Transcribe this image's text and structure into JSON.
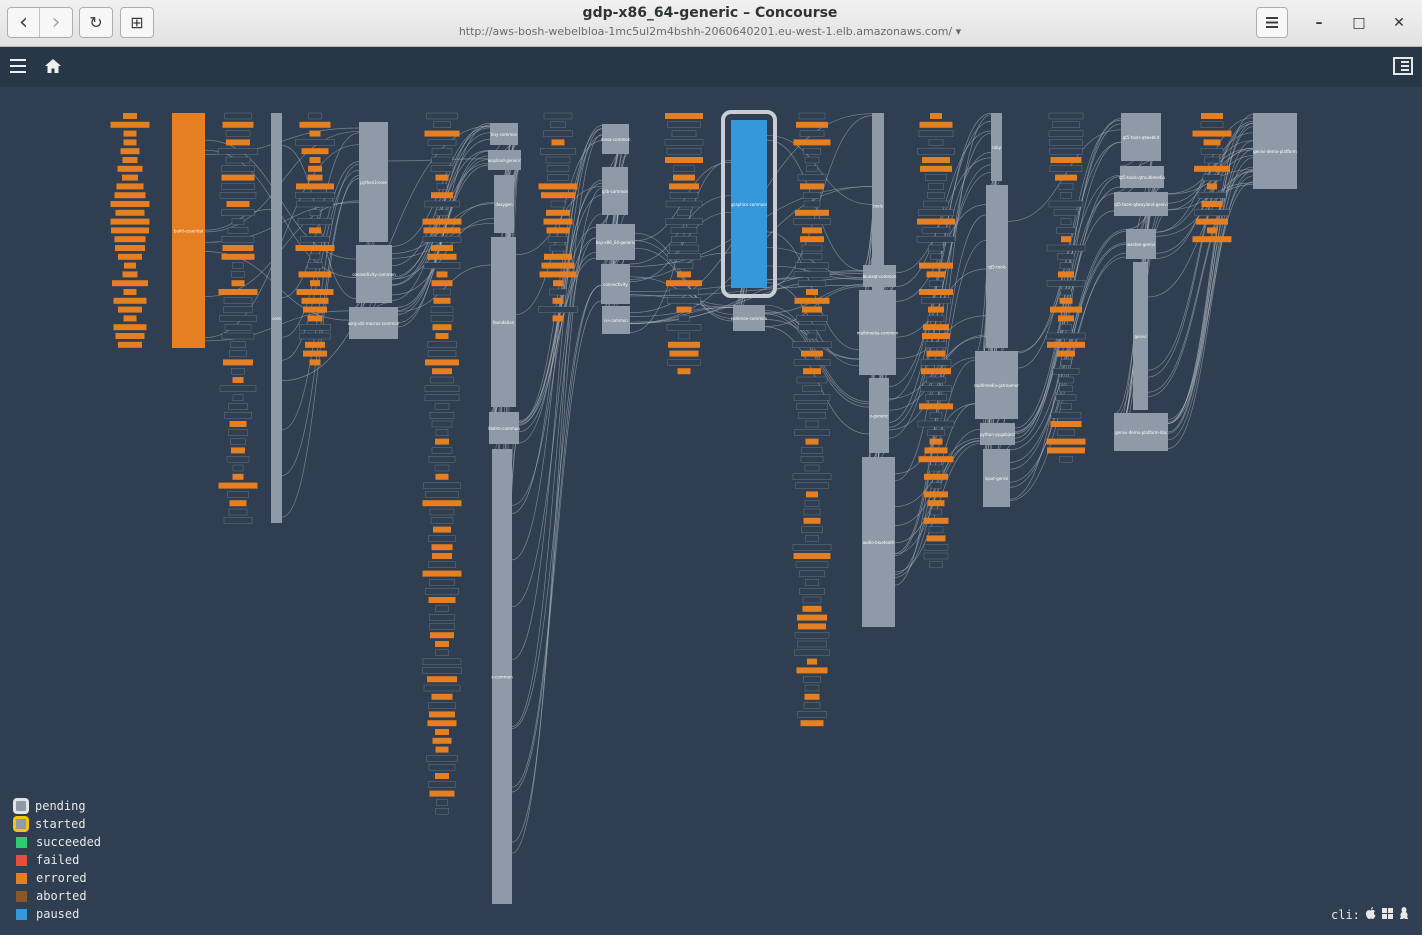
{
  "browser": {
    "window_title": "gdp-x86_64-generic – Concourse",
    "url": "http://aws-bosh-webelbloa-1mc5ul2m4bshh-2060640201.eu-west-1.elb.amazonaws.com/",
    "url_dropdown": "▾",
    "back_icon": "‹",
    "forward_icon": "›",
    "reload_icon": "↻",
    "new_tab_icon": "⊞",
    "minimize_icon": "–",
    "maximize_icon": "□",
    "close_icon": "✕"
  },
  "pipeline": {
    "jobs": [
      {
        "label": "build-essential",
        "status": "errored"
      },
      {
        "label": "core",
        "status": "pending"
      },
      {
        "label": "python3-core",
        "status": "pending"
      },
      {
        "label": "connectivity-common",
        "status": "pending"
      },
      {
        "label": "xorg-util-macros-common",
        "status": "pending"
      },
      {
        "label": "tiny-common",
        "status": "pending"
      },
      {
        "label": "wayland-generic",
        "status": "pending"
      },
      {
        "label": "doxygen",
        "status": "pending"
      },
      {
        "label": "foundation",
        "status": "pending"
      },
      {
        "label": "libdrm-common",
        "status": "pending"
      },
      {
        "label": "x-common",
        "status": "pending"
      },
      {
        "label": "mesa-common",
        "status": "pending"
      },
      {
        "label": "glib-common",
        "status": "pending"
      },
      {
        "label": "bsp-x86_64-generic",
        "status": "pending"
      },
      {
        "label": "connectivity",
        "status": "pending"
      },
      {
        "label": "ivi-common",
        "status": "pending"
      },
      {
        "label": "graphics-common",
        "status": "paused"
      },
      {
        "label": "common-common",
        "status": "pending"
      },
      {
        "label": "tools",
        "status": "pending"
      },
      {
        "label": "bluezqt-common",
        "status": "pending"
      },
      {
        "label": "multimedia-common",
        "status": "pending"
      },
      {
        "label": "x-generic",
        "status": "pending"
      },
      {
        "label": "audio-bluetooth",
        "status": "pending"
      },
      {
        "label": "ruby",
        "status": "pending"
      },
      {
        "label": "qt5-tools",
        "status": "pending"
      },
      {
        "label": "multimedia-gstreamer",
        "status": "pending"
      },
      {
        "label": "python-pygobject",
        "status": "pending"
      },
      {
        "label": "input-genivi",
        "status": "pending"
      },
      {
        "label": "qt5-tools-qtwebkit",
        "status": "pending"
      },
      {
        "label": "qt5-tools-qtmultimedia",
        "status": "pending"
      },
      {
        "label": "qt5-tools-qtwayland-genivi",
        "status": "pending"
      },
      {
        "label": "weston-genivi",
        "status": "pending"
      },
      {
        "label": "genivi",
        "status": "pending"
      },
      {
        "label": "genivi-demo-platform-libs",
        "status": "pending"
      },
      {
        "label": "genivi-demo-platform",
        "status": "pending"
      }
    ]
  },
  "legend": [
    {
      "label": "pending",
      "color": "#e3e3e3",
      "style": "ring"
    },
    {
      "label": "started",
      "color": "#f1c40f",
      "style": "ring"
    },
    {
      "label": "succeeded",
      "color": "#2ecc71",
      "style": "box"
    },
    {
      "label": "failed",
      "color": "#e74c3c",
      "style": "box"
    },
    {
      "label": "errored",
      "color": "#e67e22",
      "style": "box"
    },
    {
      "label": "aborted",
      "color": "#8b572a",
      "style": "box"
    },
    {
      "label": "paused",
      "color": "#3498db",
      "style": "box"
    }
  ],
  "cli": {
    "label": "cli:",
    "apple_icon": "",
    "windows_icon": "⊞",
    "linux_icon": "🐧"
  },
  "colors": {
    "background": "#2f3e50",
    "topbar": "#273747",
    "job_pending": "#8e9aa7",
    "resource_errored": "#e67e22",
    "paused": "#3498db",
    "edge": "#b8bfc7"
  }
}
